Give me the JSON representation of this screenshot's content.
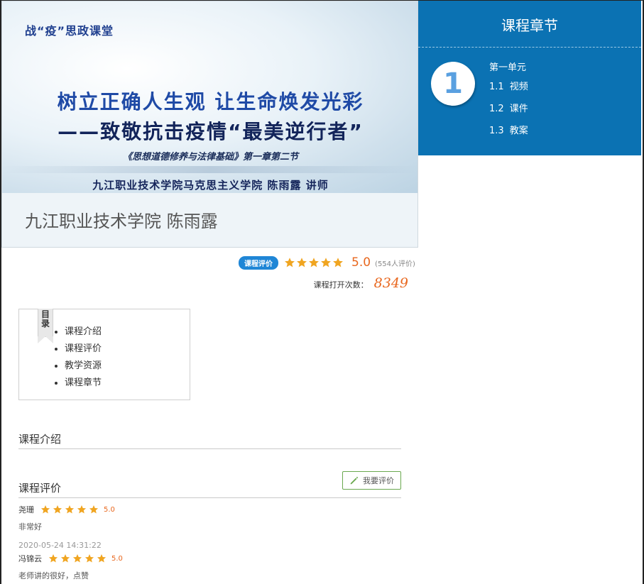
{
  "banner": {
    "tag": "战“疫”思政课堂",
    "headline1": "树立正确人生观  让生命焕发光彩",
    "headline2": "——致敬抗击疫情“最美逆行者”",
    "subtitle": "《思想道德修养与法律基础》第一章第二节",
    "lecturer_line": "九江职业技术学院马克思主义学院  陈雨露  讲师",
    "caption": "九江职业技术学院 陈雨露"
  },
  "chapters": {
    "title": "课程章节",
    "unit_number": "1",
    "unit_label": "第一单元",
    "items": [
      {
        "num": "1.1",
        "label": "视频"
      },
      {
        "num": "1.2",
        "label": "课件"
      },
      {
        "num": "1.3",
        "label": "教案"
      }
    ]
  },
  "rating": {
    "badge": "课程评价",
    "stars": 5,
    "score": "5.0",
    "count": "(554人评价)",
    "opens_label": "课程打开次数：",
    "opens_value": "8349"
  },
  "toc": {
    "ribbon": "目录",
    "items": [
      "课程介绍",
      "课程评价",
      "教学资源",
      "课程章节"
    ]
  },
  "sections": {
    "intro_title": "课程介绍",
    "review_title": "课程评价",
    "review_button": "我要评价"
  },
  "reviews": [
    {
      "user": "尧珊",
      "stars": 5,
      "score": "5.0",
      "text": "非常好",
      "time": "2020-05-24 14:31:22"
    },
    {
      "user": "冯锦云",
      "stars": 5,
      "score": "5.0",
      "text": "老师讲的很好，点赞"
    }
  ],
  "colors": {
    "panel_blue": "#0b72b3",
    "star_orange": "#f0a521",
    "score_orange": "#e8671e",
    "badge_blue": "#1f86d6",
    "button_green": "#6aa84f"
  },
  "icons": {
    "star": "star-icon",
    "edit": "pencil-icon"
  }
}
